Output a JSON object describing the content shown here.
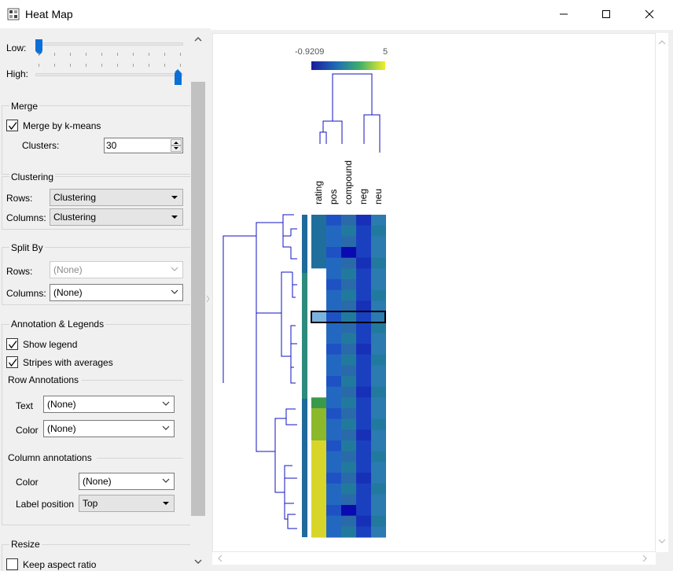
{
  "window": {
    "title": "Heat Map"
  },
  "levels": {
    "low_label": "Low:",
    "high_label": "High:",
    "low": 0.0,
    "high": 1.0
  },
  "merge": {
    "title": "Merge",
    "kmeans_label": "Merge by k-means",
    "kmeans_checked": true,
    "clusters_label": "Clusters:",
    "clusters_value": "30"
  },
  "clustering": {
    "title": "Clustering",
    "rows_label": "Rows:",
    "rows_value": "Clustering",
    "columns_label": "Columns:",
    "columns_value": "Clustering"
  },
  "split_by": {
    "title": "Split By",
    "rows_label": "Rows:",
    "rows_value": "(None)",
    "columns_label": "Columns:",
    "columns_value": "(None)"
  },
  "annotation": {
    "title": "Annotation & Legends",
    "show_legend_label": "Show legend",
    "show_legend_checked": true,
    "stripes_label": "Stripes with averages",
    "stripes_checked": true,
    "row_title": "Row Annotations",
    "row_text_label": "Text",
    "row_text_value": "(None)",
    "row_color_label": "Color",
    "row_color_value": "(None)",
    "col_title": "Column annotations",
    "col_color_label": "Color",
    "col_color_value": "(None)",
    "label_position_label": "Label position",
    "label_position_value": "Top"
  },
  "resize": {
    "title": "Resize",
    "keep_aspect_label": "Keep aspect ratio",
    "keep_aspect_checked": false
  },
  "legend": {
    "min_label": "-0.9209",
    "max_label": "5",
    "colors": [
      "#1b1b9c",
      "#1f6fb5",
      "#3fae6a",
      "#f2ee2a"
    ]
  },
  "columns": [
    "rating",
    "pos",
    "compound",
    "neg",
    "neu"
  ],
  "colors": {
    "accent": "#0a6fd6",
    "dendrogram": "#1010c0",
    "stripe_blue": "#1f6a9a",
    "stripe_teal": "#2d8a7c"
  }
}
